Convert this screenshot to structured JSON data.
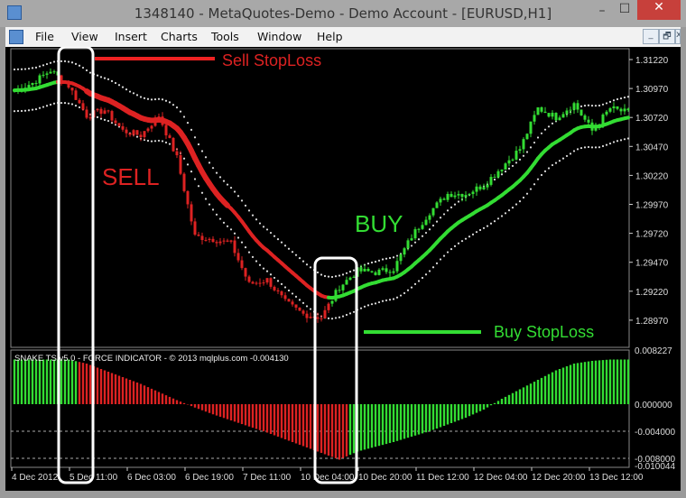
{
  "window": {
    "title": "1348140 - MetaQuotes-Demo - Demo Account - [EURUSD,H1]",
    "minimize": "–",
    "maximize": "☐",
    "close": "✕"
  },
  "menu": [
    "File",
    "View",
    "Insert",
    "Charts",
    "Tools",
    "Window",
    "Help"
  ],
  "mdi_buttons": [
    "_",
    "🗗",
    "x"
  ],
  "indicator_label": "SNAKE TS v5.0 - FORCE INDICATOR - © 2013 mqlplus.com   -0.004130",
  "annotations": {
    "sell_stoploss": "Sell StopLoss",
    "buy_stoploss": "Buy StopLoss",
    "sell": "SELL",
    "buy": "BUY"
  },
  "colors": {
    "bull": "#33dd33",
    "bear": "#dd2222",
    "background": "#000000",
    "band": "#dddddd"
  },
  "chart_data": {
    "type": "candlestick",
    "symbol": "EURUSD",
    "timeframe": "H1",
    "price_axis": [
      "1.31220",
      "1.30970",
      "1.30720",
      "1.30470",
      "1.30220",
      "1.29970",
      "1.29720",
      "1.29470",
      "1.29220",
      "1.28970"
    ],
    "ylim": [
      1.288,
      1.3135
    ],
    "time_axis": [
      "4 Dec 2012",
      "5 Dec 11:00",
      "6 Dec 03:00",
      "6 Dec 19:00",
      "7 Dec 11:00",
      "10 Dec 04:00",
      "10 Dec 20:00",
      "11 Dec 12:00",
      "12 Dec 04:00",
      "12 Dec 20:00",
      "13 Dec 12:00"
    ],
    "close_every_5_bars": [
      1.30955,
      1.31017,
      1.31127,
      1.30994,
      1.30737,
      1.30784,
      1.30605,
      1.30566,
      1.30737,
      1.30371,
      1.29693,
      1.2967,
      1.29631,
      1.2928,
      1.29319,
      1.29125,
      1.29023,
      1.28992,
      1.29257,
      1.29397,
      1.29382,
      1.29413,
      1.29693,
      1.29904,
      1.3006,
      1.3006,
      1.30137,
      1.30293,
      1.30449,
      1.30799,
      1.30722,
      1.30838,
      1.30605,
      1.30799,
      1.3076
    ],
    "trend_every_5_bars": [
      "up",
      "up",
      "up",
      "down",
      "down",
      "down",
      "down",
      "down",
      "down",
      "down",
      "down",
      "down",
      "down",
      "down",
      "down",
      "down",
      "down",
      "down",
      "up",
      "up",
      "up",
      "up",
      "up",
      "up",
      "up",
      "up",
      "up",
      "up",
      "up",
      "up",
      "up",
      "up",
      "up",
      "up",
      "up"
    ],
    "indicator": {
      "name": "SNAKE TS v5.0 - FORCE INDICATOR",
      "current": -0.00413,
      "axis": [
        "0.008227",
        "0.000000",
        "-0.004000",
        "-0.008000",
        "-0.010044"
      ],
      "ylim": [
        -0.010044,
        0.008227
      ],
      "levels": [
        -0.004,
        -0.008
      ],
      "values_every_5_bars": [
        0.0066,
        0.0066,
        0.0066,
        0.0066,
        0.006,
        0.005,
        0.004,
        0.003,
        0.0018,
        0.0006,
        -0.0005,
        -0.0015,
        -0.0024,
        -0.0033,
        -0.0042,
        -0.0052,
        -0.0062,
        -0.0072,
        -0.0082,
        -0.007,
        -0.0063,
        -0.0056,
        -0.0048,
        -0.004,
        -0.003,
        -0.002,
        -0.0008,
        0.0008,
        0.0022,
        0.0036,
        0.005,
        0.006,
        0.0064,
        0.0066,
        0.0066
      ],
      "colors_every_5_bars": [
        "up",
        "up",
        "up",
        "up",
        "down",
        "down",
        "down",
        "down",
        "down",
        "down",
        "down",
        "down",
        "down",
        "down",
        "down",
        "down",
        "down",
        "down",
        "down",
        "up",
        "up",
        "up",
        "up",
        "up",
        "up",
        "up",
        "up",
        "up",
        "up",
        "up",
        "up",
        "up",
        "up",
        "up",
        "up"
      ]
    }
  }
}
